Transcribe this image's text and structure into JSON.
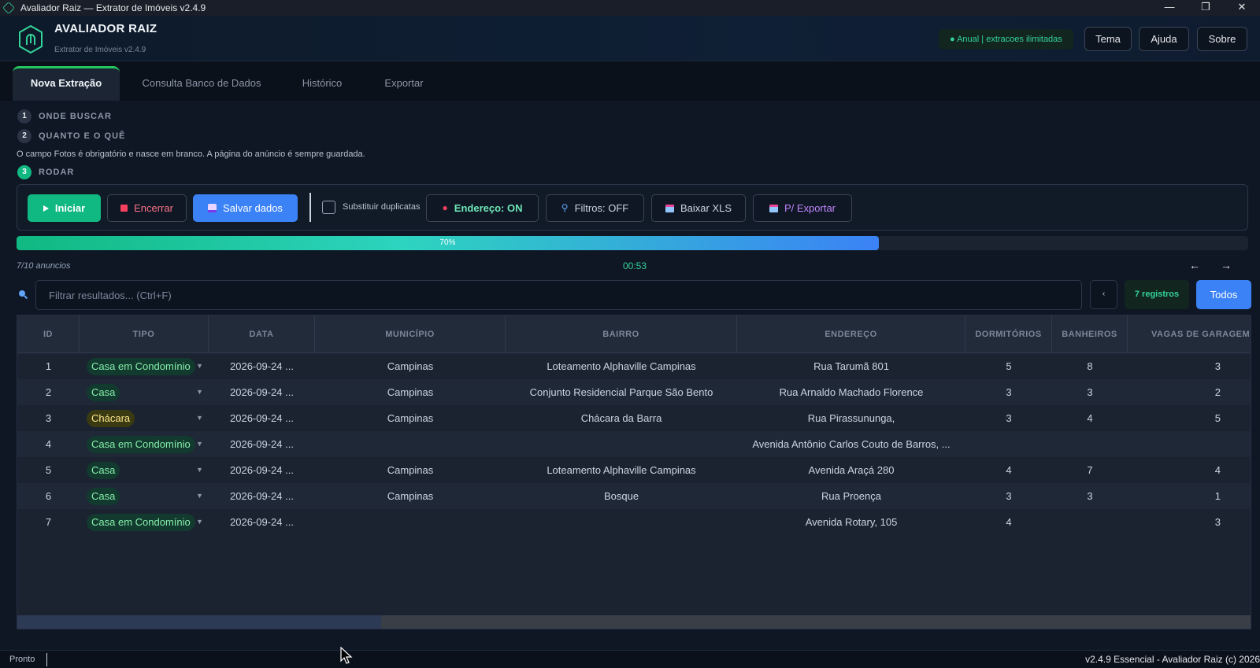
{
  "window": {
    "title": "Avaliador Raiz — Extrator de Imóveis v2.4.9",
    "controls": [
      "—",
      "❐",
      "✕"
    ]
  },
  "header": {
    "brand": "AVALIADOR RAIZ",
    "subtitle": "Extrator de Imóveis v2.4.9",
    "plan_badge": "● Anual | extracoes ilimitadas",
    "buttons": {
      "theme": "Tema",
      "help": "Ajuda",
      "about": "Sobre"
    }
  },
  "tabs": [
    "Nova Extração",
    "Consulta Banco de Dados",
    "Histórico",
    "Exportar"
  ],
  "steps": [
    {
      "num": "1",
      "label": "ONDE BUSCAR"
    },
    {
      "num": "2",
      "label": "QUANTO E O QUÊ"
    },
    {
      "num": "3",
      "label": "RODAR"
    }
  ],
  "note": "O campo Fotos é obrigatório e nasce em branco. A página do anúncio é sempre guardada.",
  "toolbar": {
    "start": "Iniciar",
    "stop": "Encerrar",
    "save": "Salvar dados",
    "replace_duplicates": "Substituir duplicatas",
    "address": "Endereço: ON",
    "filters": "Filtros: OFF",
    "download_xls": "Baixar XLS",
    "export": "P/ Exportar"
  },
  "progress": {
    "percent": 70,
    "label": "70%"
  },
  "status": {
    "count_text": "7/10 anuncios",
    "timer": "00:53",
    "arrow_left": "←",
    "arrow_right": "→"
  },
  "search": {
    "placeholder": "Filtrar resultados... (Ctrl+F)",
    "small_btn": "‹",
    "records": "7 registros",
    "all": "Todos"
  },
  "table": {
    "columns": [
      "ID",
      "TIPO",
      "DATA",
      "MUNICÍPIO",
      "BAIRRO",
      "ENDEREÇO",
      "DORMITÓRIOS",
      "BANHEIROS",
      "VAGAS DE GARAGEM"
    ],
    "rows": [
      {
        "id": "1",
        "tipo": "Casa em Condomínio",
        "tipo_color": "green",
        "data": "2026-09-24 ...",
        "municipio": "Campinas",
        "bairro": "Loteamento Alphaville Campinas",
        "endereco": "Rua Tarumã 801",
        "dorm": "5",
        "banh": "8",
        "vagas": "3"
      },
      {
        "id": "2",
        "tipo": "Casa",
        "tipo_color": "green",
        "data": "2026-09-24 ...",
        "municipio": "Campinas",
        "bairro": "Conjunto Residencial Parque São Bento",
        "endereco": "Rua Arnaldo Machado Florence",
        "dorm": "3",
        "banh": "3",
        "vagas": "2"
      },
      {
        "id": "3",
        "tipo": "Chácara",
        "tipo_color": "yellow",
        "data": "2026-09-24 ...",
        "municipio": "Campinas",
        "bairro": "Chácara da Barra",
        "endereco": "Rua Pirassununga,",
        "dorm": "3",
        "banh": "4",
        "vagas": "5"
      },
      {
        "id": "4",
        "tipo": "Casa em Condomínio",
        "tipo_color": "green",
        "data": "2026-09-24 ...",
        "municipio": "",
        "bairro": "",
        "endereco": "Avenida Antônio Carlos Couto de Barros, ...",
        "dorm": "",
        "banh": "",
        "vagas": ""
      },
      {
        "id": "5",
        "tipo": "Casa",
        "tipo_color": "green",
        "data": "2026-09-24 ...",
        "municipio": "Campinas",
        "bairro": "Loteamento Alphaville Campinas",
        "endereco": "Avenida Araçá 280",
        "dorm": "4",
        "banh": "7",
        "vagas": "4"
      },
      {
        "id": "6",
        "tipo": "Casa",
        "tipo_color": "green",
        "data": "2026-09-24 ...",
        "municipio": "Campinas",
        "bairro": "Bosque",
        "endereco": "Rua Proença",
        "dorm": "3",
        "banh": "3",
        "vagas": "1"
      },
      {
        "id": "7",
        "tipo": "Casa em Condomínio",
        "tipo_color": "green",
        "data": "2026-09-24 ...",
        "municipio": "",
        "bairro": "",
        "endereco": "Avenida Rotary, 105",
        "dorm": "4",
        "banh": "",
        "vagas": "3"
      }
    ]
  },
  "statusbar": {
    "left": "Pronto",
    "right": "v2.4.9 Essencial - Avaliador Raiz (c) 2026"
  },
  "colors": {
    "accent_green": "#10b981",
    "accent_blue": "#3b82f6",
    "danger": "#f43f5e",
    "purple": "#c084fc"
  }
}
